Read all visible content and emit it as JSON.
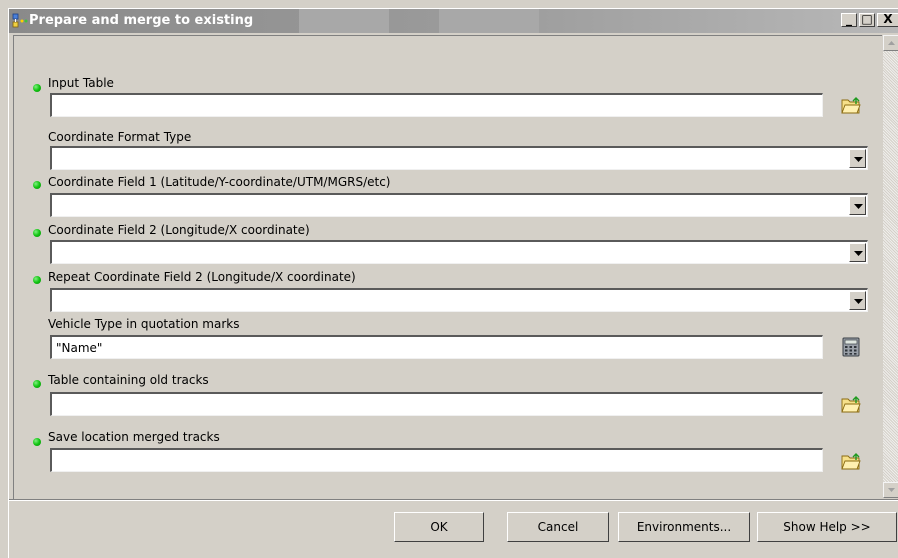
{
  "window": {
    "title": "Prepare and merge to existing",
    "controls": {
      "minimize": "_",
      "maximize": "□",
      "close": "X"
    }
  },
  "fields": [
    {
      "label": "Input Table",
      "required": true,
      "type": "text",
      "value": "",
      "browse_icon": "open-folder-icon"
    },
    {
      "label": "Coordinate Format Type",
      "required": false,
      "type": "dropdown",
      "value": ""
    },
    {
      "label": "Coordinate Field 1 (Latitude/Y-coordinate/UTM/MGRS/etc)",
      "required": true,
      "type": "dropdown",
      "value": ""
    },
    {
      "label": "Coordinate Field 2 (Longitude/X coordinate)",
      "required": true,
      "type": "dropdown",
      "value": ""
    },
    {
      "label": "Repeat Coordinate Field 2 (Longitude/X coordinate)",
      "required": true,
      "type": "dropdown",
      "value": ""
    },
    {
      "label": "Vehicle Type in quotation marks",
      "required": false,
      "type": "text",
      "value": "\"Name\"",
      "browse_icon": "calculator-icon"
    },
    {
      "label": "Table containing old tracks",
      "required": true,
      "type": "text",
      "value": "",
      "browse_icon": "open-folder-icon"
    },
    {
      "label": "Save location merged tracks",
      "required": true,
      "type": "text",
      "value": "",
      "browse_icon": "open-folder-icon"
    }
  ],
  "buttons": {
    "ok": "OK",
    "cancel": "Cancel",
    "environments": "Environments...",
    "show_help": "Show Help >>"
  },
  "colors": {
    "required_dot": "#12c412",
    "dialog_bg": "#d4d0c8",
    "titlebar": "#9c9c9c"
  }
}
